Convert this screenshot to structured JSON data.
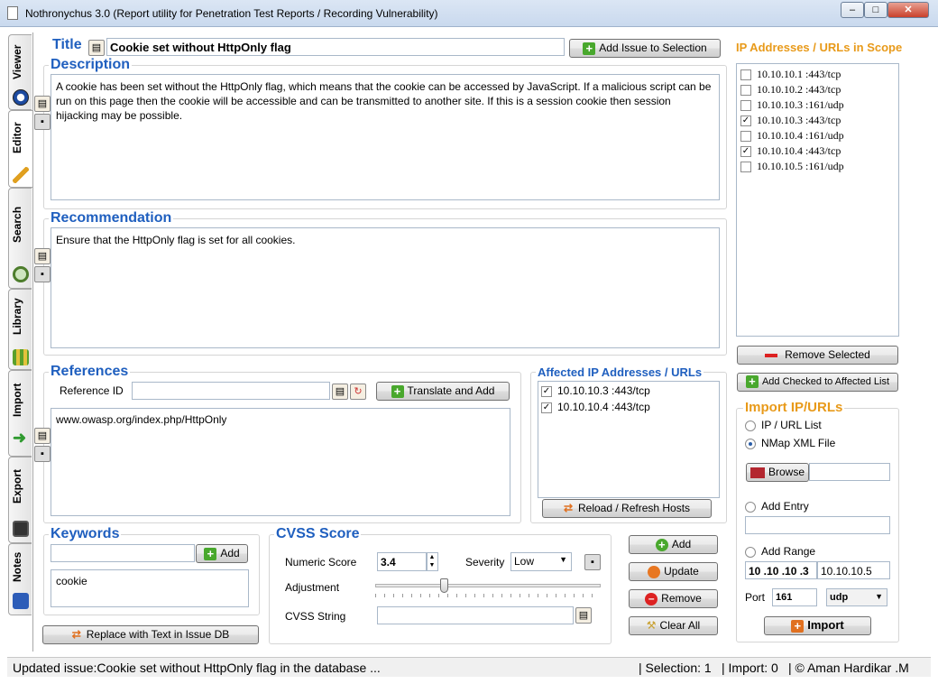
{
  "window": {
    "title": "Nothronychus 3.0 (Report utility for Penetration Test Reports / Recording Vulnerability)",
    "buttons": {
      "minimize": "–",
      "maximize": "□",
      "close": "✕"
    }
  },
  "tabs": [
    {
      "label": "Viewer",
      "icon": "eye-icon"
    },
    {
      "label": "Editor",
      "icon": "pencil-icon"
    },
    {
      "label": "Search",
      "icon": "magnifier-icon"
    },
    {
      "label": "Library",
      "icon": "books-icon"
    },
    {
      "label": "Import",
      "icon": "arrow-icon"
    },
    {
      "label": "Export",
      "icon": "disk-icon"
    },
    {
      "label": "Notes",
      "icon": "notebook-icon"
    }
  ],
  "editor": {
    "title_label": "Title",
    "title_value": "Cookie set without HttpOnly flag",
    "add_issue_button": "Add Issue to Selection",
    "description_label": "Description",
    "description_text": "A cookie has been set without the HttpOnly flag, which means that the cookie can be accessed by JavaScript. If a malicious script can be run on this page then the cookie will be accessible and can be transmitted to another site. If this is a session cookie then session hijacking may be possible.",
    "recommendation_label": "Recommendation",
    "recommendation_text": "Ensure that the HttpOnly flag is set for all cookies.",
    "references_label": "References",
    "reference_id_label": "Reference ID",
    "reference_id_value": "",
    "translate_button": "Translate and Add",
    "references_text": "www.owasp.org/index.php/HttpOnly",
    "affected_label": "Affected IP Addresses / URLs",
    "affected_hosts": [
      {
        "text": "10.10.10.3 :443/tcp",
        "checked": true
      },
      {
        "text": "10.10.10.4 :443/tcp",
        "checked": true
      }
    ],
    "reload_button": "Reload / Refresh Hosts",
    "keywords_label": "Keywords",
    "keyword_input": "",
    "keyword_add_button": "Add",
    "keywords_list": "cookie",
    "replace_button": "Replace with Text in Issue DB",
    "cvss_label": "CVSS Score",
    "numeric_score_label": "Numeric Score",
    "numeric_score_value": "3.4",
    "severity_label": "Severity",
    "severity_value": "Low",
    "adjustment_label": "Adjustment",
    "adjustment_level": 0.3,
    "cvss_string_label": "CVSS String",
    "cvss_string_value": "",
    "actions": {
      "add": "Add",
      "update": "Update",
      "remove": "Remove",
      "clear": "Clear All"
    }
  },
  "scope": {
    "label": "IP Addresses / URLs in Scope",
    "hosts": [
      {
        "text": "10.10.10.1 :443/tcp",
        "checked": false
      },
      {
        "text": "10.10.10.2 :443/tcp",
        "checked": false
      },
      {
        "text": "10.10.10.3 :161/udp",
        "checked": false
      },
      {
        "text": "10.10.10.3 :443/tcp",
        "checked": true
      },
      {
        "text": "10.10.10.4 :161/udp",
        "checked": false
      },
      {
        "text": "10.10.10.4 :443/tcp",
        "checked": true
      },
      {
        "text": "10.10.10.5 :161/udp",
        "checked": false
      }
    ],
    "remove_selected_button": "Remove Selected",
    "add_checked_button": "Add Checked to Affected List"
  },
  "import": {
    "label": "Import IP/URLs",
    "option_list": "IP / URL List",
    "option_nmap": "NMap XML File",
    "browse_button": "Browse",
    "add_entry_label": "Add Entry",
    "add_range_label": "Add Range",
    "range_start": "10 .10 .10 .3",
    "range_end": "10.10.10.5",
    "port_label": "Port",
    "port_value": "161",
    "protocol_value": "udp",
    "import_button": "Import"
  },
  "status": {
    "message": "Updated issue:Cookie set without HttpOnly flag in the database ...",
    "selection": "| Selection: 1",
    "import": "| Import: 0",
    "author": "| © Aman Hardikar .M"
  }
}
